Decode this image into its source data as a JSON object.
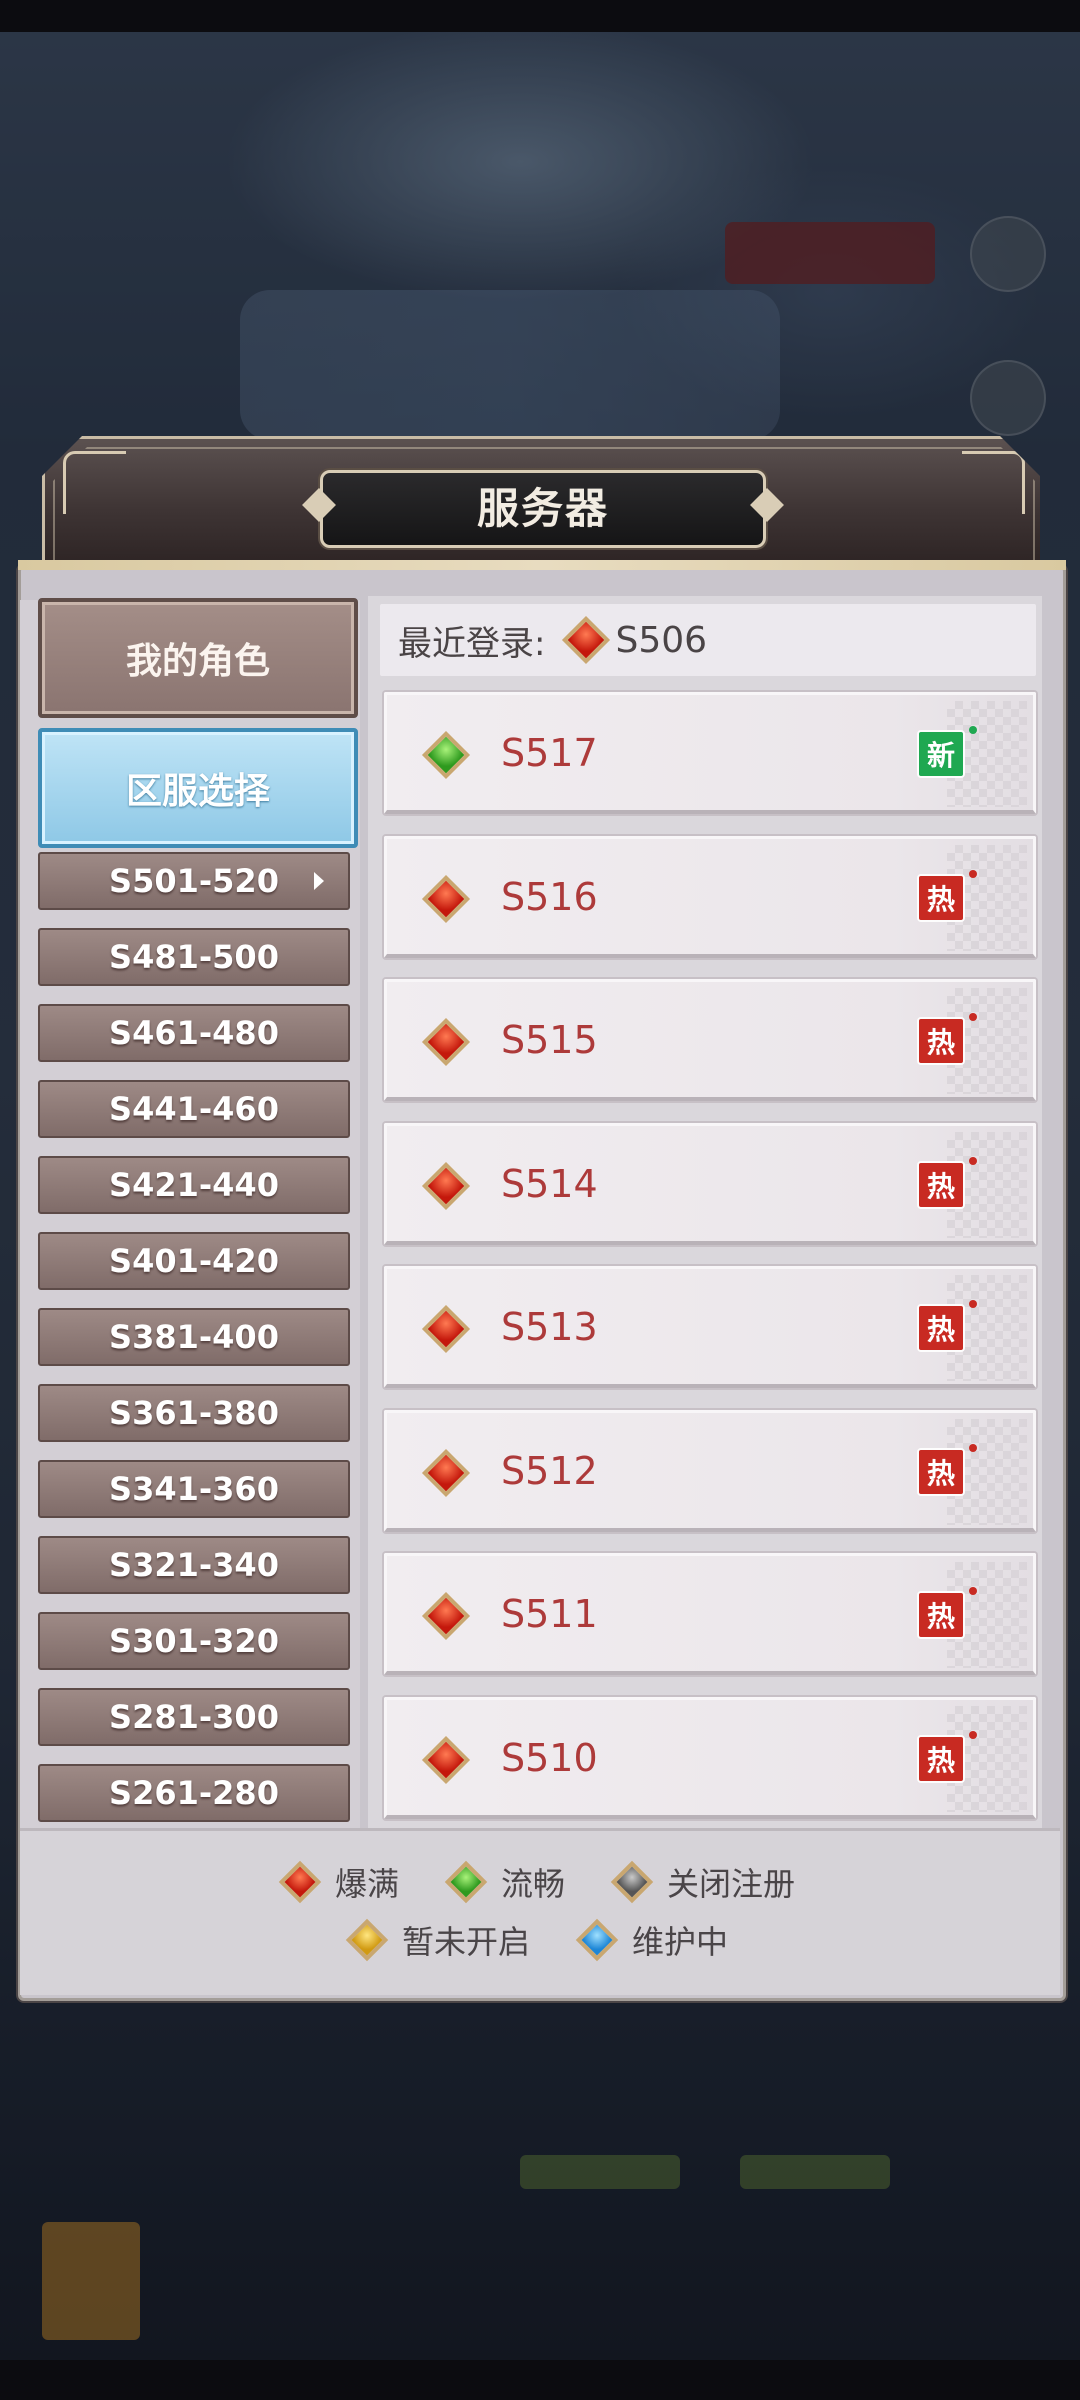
{
  "header": {
    "title": "服务器"
  },
  "sidebar": {
    "role_label": "我的角色",
    "zone_label": "区服选择",
    "ranges": [
      "S501-520",
      "S481-500",
      "S461-480",
      "S441-460",
      "S421-440",
      "S401-420",
      "S381-400",
      "S361-380",
      "S341-360",
      "S321-340",
      "S301-320",
      "S281-300",
      "S261-280"
    ],
    "selected_range": "S501-520"
  },
  "recent": {
    "label": "最近登录:",
    "server": "S506",
    "status": "red"
  },
  "servers": [
    {
      "name": "S517",
      "status": "green",
      "tag": "新"
    },
    {
      "name": "S516",
      "status": "red",
      "tag": "热"
    },
    {
      "name": "S515",
      "status": "red",
      "tag": "热"
    },
    {
      "name": "S514",
      "status": "red",
      "tag": "热"
    },
    {
      "name": "S513",
      "status": "red",
      "tag": "热"
    },
    {
      "name": "S512",
      "status": "red",
      "tag": "热"
    },
    {
      "name": "S511",
      "status": "red",
      "tag": "热"
    },
    {
      "name": "S510",
      "status": "red",
      "tag": "热"
    }
  ],
  "legend": [
    {
      "label": "爆满",
      "color": "red"
    },
    {
      "label": "流畅",
      "color": "green"
    },
    {
      "label": "关闭注册",
      "color": "gray"
    },
    {
      "label": "暂未开启",
      "color": "yellow"
    },
    {
      "label": "维护中",
      "color": "blue"
    }
  ],
  "colors": {
    "accent_blue": "#8ec8e6",
    "server_name": "#ad3a3a",
    "hot_tag": "#c82a22",
    "new_tag": "#1fa851"
  }
}
